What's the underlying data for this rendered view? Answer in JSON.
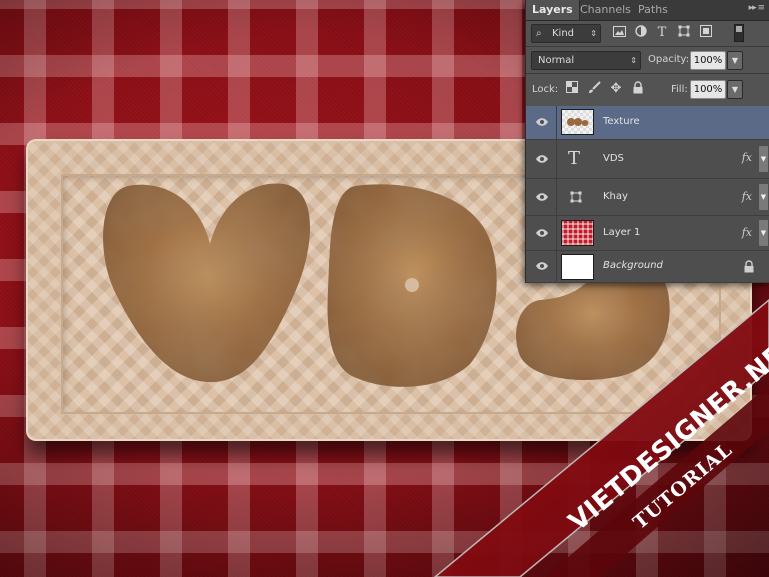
{
  "panel": {
    "tabs": [
      "Layers",
      "Channels",
      "Paths"
    ],
    "filter": {
      "kind_label": "Kind"
    },
    "blend_mode": "Normal",
    "opacity_label": "Opacity:",
    "opacity_value": "100%",
    "lock_label": "Lock:",
    "fill_label": "Fill:",
    "fill_value": "100%",
    "layers": [
      {
        "name": "Texture",
        "selected": true,
        "fx": false,
        "thumb": "texture"
      },
      {
        "name": "VDS",
        "selected": false,
        "fx": true,
        "thumb": "text"
      },
      {
        "name": "Khay",
        "selected": false,
        "fx": true,
        "thumb": "shape"
      },
      {
        "name": "Layer 1",
        "selected": false,
        "fx": true,
        "thumb": "gingham"
      },
      {
        "name": "Background",
        "selected": false,
        "fx": false,
        "thumb": "white",
        "locked": true
      }
    ],
    "fx_label": "fx"
  },
  "watermark": {
    "site": "VIETDESIGNER.NET",
    "tag": "TUTORIAL",
    "color": "#7d0a10"
  },
  "colors": {
    "canvas_red": "#8e1119",
    "tray": "#d9bea3",
    "letter_brown": "#9a6a3e",
    "panel_bg": "#535353",
    "selected_layer": "#5b6a86"
  }
}
